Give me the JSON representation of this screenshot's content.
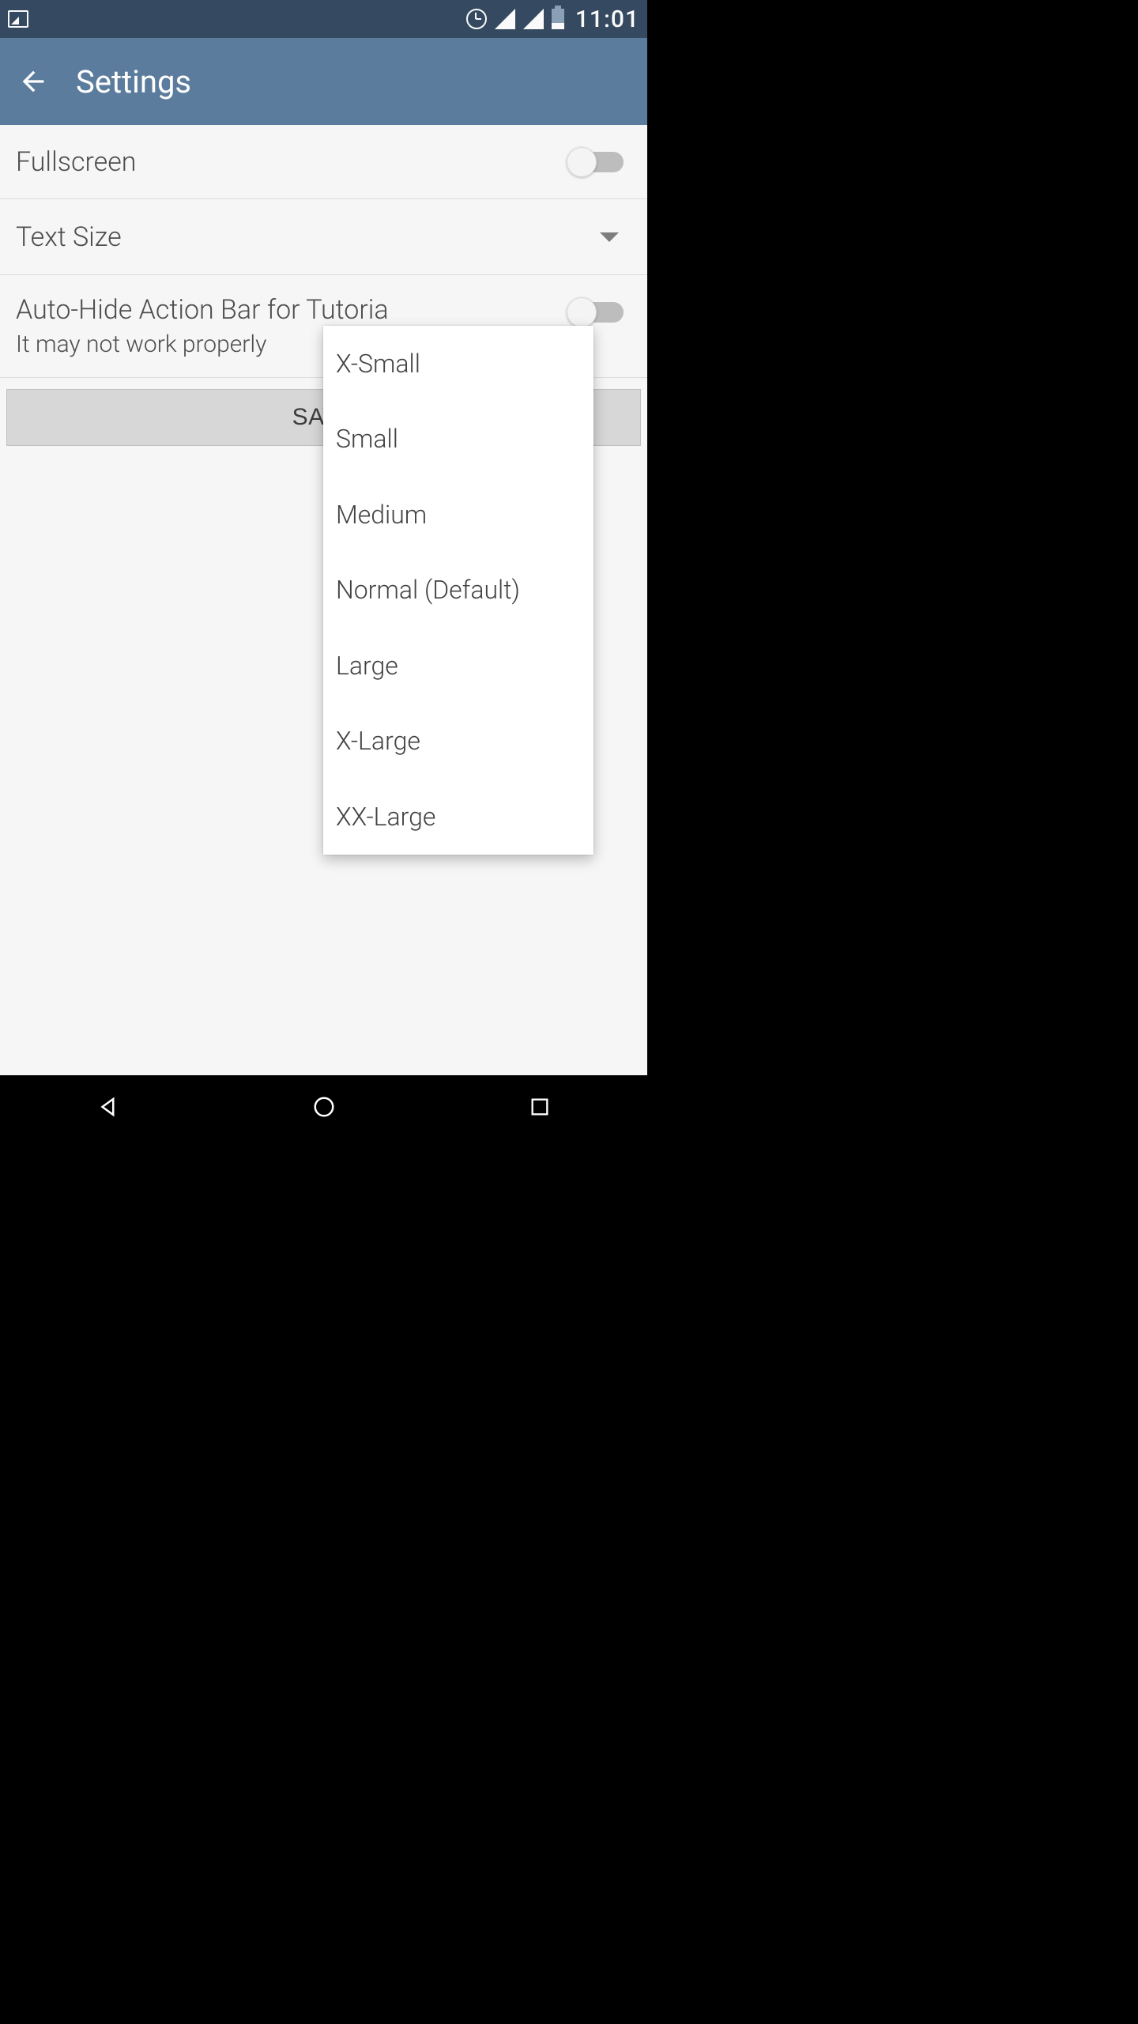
{
  "statusbar": {
    "time": "11:01"
  },
  "appbar": {
    "title": "Settings"
  },
  "settings": {
    "fullscreen_label": "Fullscreen",
    "fullscreen_on": false,
    "text_size_label": "Text Size",
    "text_size_value": "Normal (Default)",
    "autohide_label": "Auto-Hide Action Bar for Tutoria",
    "autohide_sub": "It may not work properly",
    "autohide_on": false,
    "save_label": "SAVE"
  },
  "text_size_options": [
    "X-Small",
    "Small",
    "Medium",
    "Normal (Default)",
    "Large",
    "X-Large",
    "XX-Large"
  ]
}
